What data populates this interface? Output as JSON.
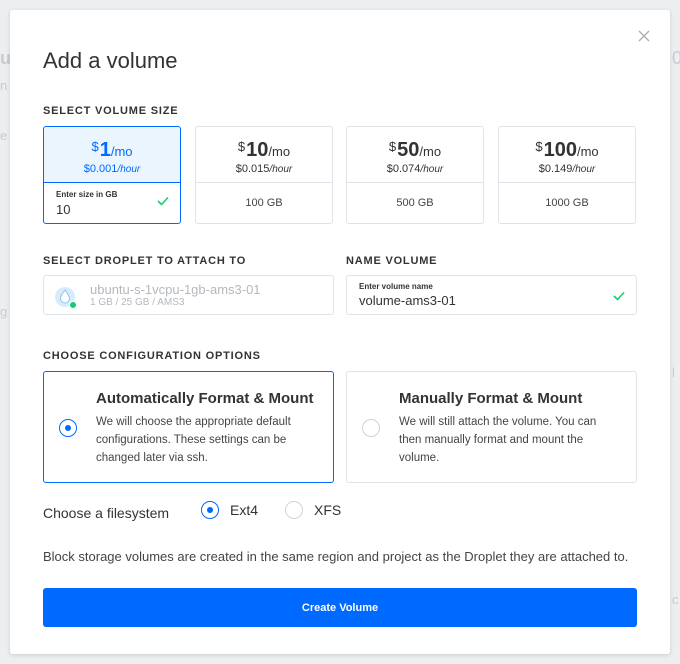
{
  "modal": {
    "title": "Add a volume",
    "close_label": "×"
  },
  "volume_size": {
    "section_label": "SELECT VOLUME SIZE",
    "options": [
      {
        "currency": "$",
        "amount": "1",
        "period": "/mo",
        "hourly_amount": "$0.001",
        "hourly_unit": "/hour",
        "size": "",
        "custom_label": "Enter size in GB",
        "custom_value": "10",
        "selected": true
      },
      {
        "currency": "$",
        "amount": "10",
        "period": "/mo",
        "hourly_amount": "$0.015",
        "hourly_unit": "/hour",
        "size": "100 GB",
        "selected": false
      },
      {
        "currency": "$",
        "amount": "50",
        "period": "/mo",
        "hourly_amount": "$0.074",
        "hourly_unit": "/hour",
        "size": "500 GB",
        "selected": false
      },
      {
        "currency": "$",
        "amount": "100",
        "period": "/mo",
        "hourly_amount": "$0.149",
        "hourly_unit": "/hour",
        "size": "1000 GB",
        "selected": false
      }
    ]
  },
  "droplet": {
    "section_label": "SELECT DROPLET TO ATTACH TO",
    "name": "ubuntu-s-1vcpu-1gb-ams3-01",
    "specs": "1 GB / 25 GB / AMS3"
  },
  "name_volume": {
    "section_label": "NAME VOLUME",
    "field_label": "Enter volume name",
    "value": "volume-ams3-01"
  },
  "config": {
    "section_label": "CHOOSE CONFIGURATION OPTIONS",
    "options": [
      {
        "title": "Automatically Format & Mount",
        "description": "We will choose the appropriate default configurations. These settings can be changed later via ssh.",
        "selected": true
      },
      {
        "title": "Manually Format & Mount",
        "description": "We will still attach the volume. You can then manually format and mount the volume.",
        "selected": false
      }
    ]
  },
  "filesystem": {
    "label": "Choose a filesystem",
    "options": [
      {
        "label": "Ext4",
        "selected": true
      },
      {
        "label": "XFS",
        "selected": false
      }
    ]
  },
  "note": "Block storage volumes are created in the same region and project as the Droplet they are attached to.",
  "create_button": "Create Volume",
  "background": {
    "fragments": [
      "ul",
      "n",
      "e",
      "g",
      "0",
      "l",
      "c"
    ]
  },
  "colors": {
    "primary": "#0069ff",
    "selected_bg": "#ebf5fd",
    "success": "#15cd72",
    "border": "#dfe3e8"
  }
}
